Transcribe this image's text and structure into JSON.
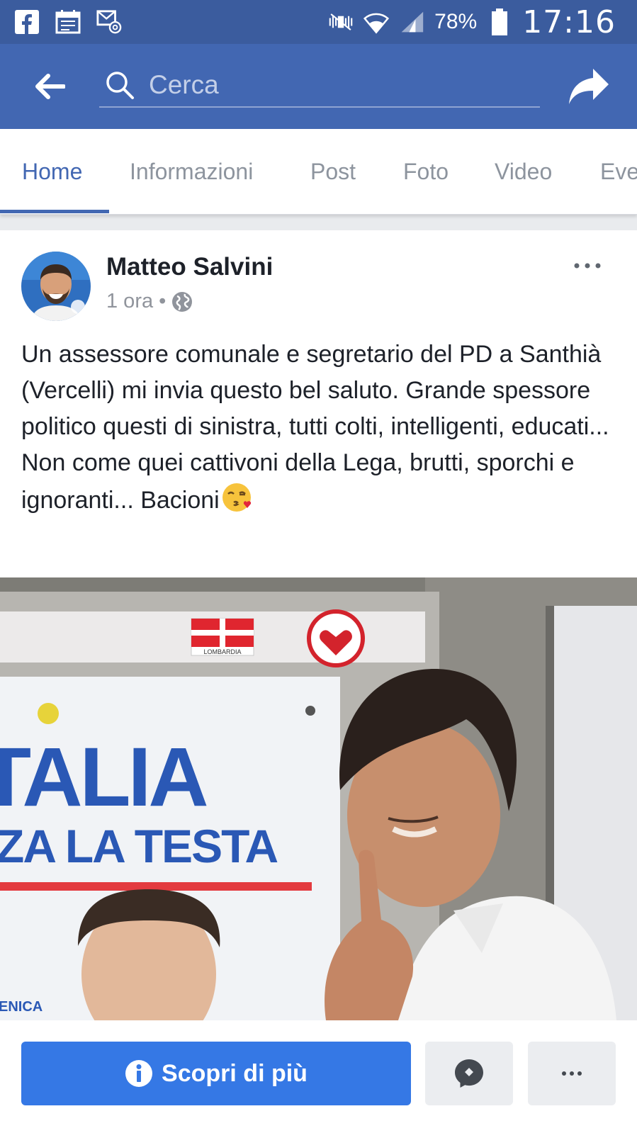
{
  "status_bar": {
    "battery": "78%",
    "time": "17:16",
    "icons": [
      "facebook-icon",
      "calendar-icon",
      "email-icon",
      "mute-icon",
      "wifi-icon",
      "signal-icon",
      "battery-icon"
    ]
  },
  "app_bar": {
    "search_placeholder": "Cerca",
    "back_icon": "back-arrow-icon",
    "share_icon": "share-icon",
    "colors": {
      "status_bar": "#3b5c9e",
      "app_bar": "#4267b2"
    }
  },
  "tabs": [
    {
      "label": "Home",
      "active": true
    },
    {
      "label": "Informazioni",
      "active": false
    },
    {
      "label": "Post",
      "active": false
    },
    {
      "label": "Foto",
      "active": false
    },
    {
      "label": "Video",
      "active": false
    },
    {
      "label": "Eve",
      "active": false
    }
  ],
  "post": {
    "author": "Matteo Salvini",
    "time": "1 ora",
    "separator": "•",
    "audience_icon": "globe-icon",
    "text": "Un assessore comunale e segretario del PD a Santhià (Vercelli) mi invia questo bel saluto. Grande spessore politico questi di sinistra, tutti colti, intelligenti, educati... Non come quei cattivoni della Lega, brutti, sporchi e ignoranti... Bacioni",
    "emoji": "kiss-emoji",
    "photo_text": {
      "line1": "TALIA",
      "line2": "ZA LA TESTA",
      "footer": "ENICA",
      "badge": "LOMBARDIA"
    }
  },
  "actions": {
    "cta_label": "Scopri di più",
    "cta_color": "#3578e5",
    "messenger_icon": "messenger-icon",
    "more_icon": "more-icon"
  }
}
